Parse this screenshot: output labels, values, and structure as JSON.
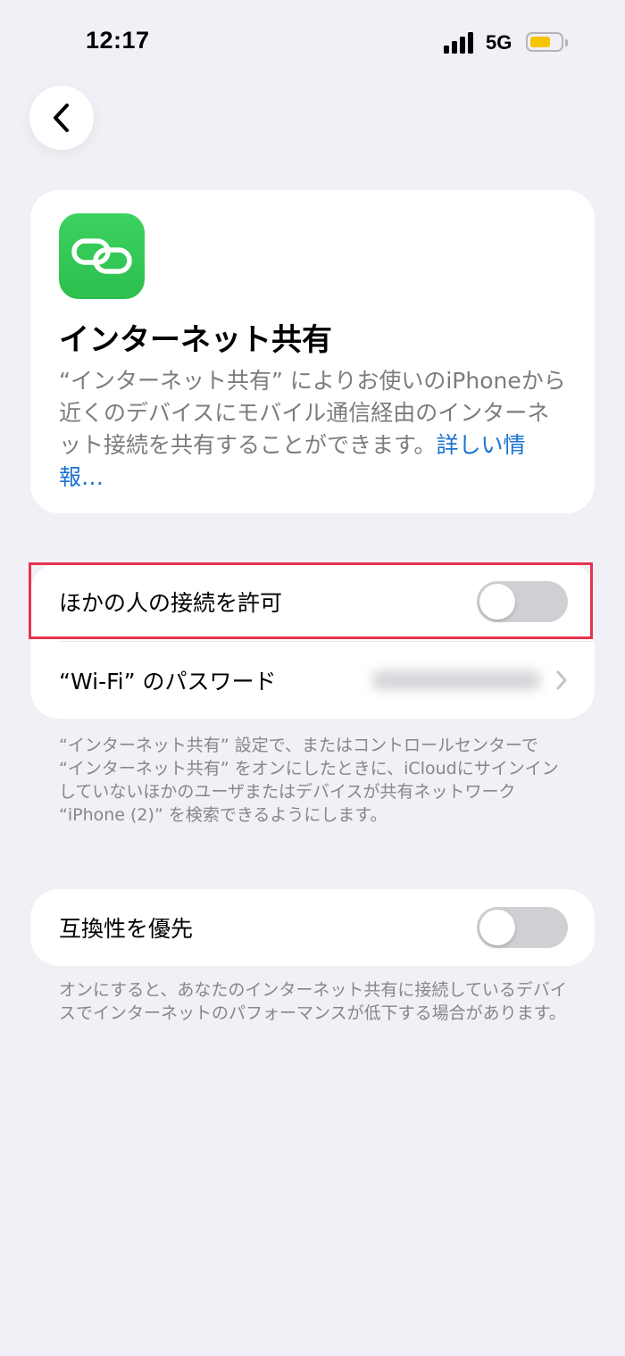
{
  "status_bar": {
    "time": "12:17",
    "network": "5G"
  },
  "header": {
    "back_icon": "chevron-left-icon"
  },
  "hero": {
    "icon": "link-icon",
    "title": "インターネット共有",
    "description": "“インターネット共有” によりお使いのiPhoneから近くのデバイスにモバイル通信経由のインターネット接続を共有することができます。",
    "link": "詳しい情報…"
  },
  "settings_group_1": {
    "allow_others": {
      "label": "ほかの人の接続を許可",
      "enabled": false
    },
    "wifi_password": {
      "label": "“Wi-Fi” のパスワード"
    }
  },
  "footnote_1": "“インターネット共有” 設定で、またはコントロールセンターで “インターネット共有” をオンにしたときに、iCloudにサインインしていないほかのユーザまたはデバイスが共有ネットワーク “iPhone (2)” を検索できるようにします。",
  "settings_group_2": {
    "maximize_compatibility": {
      "label": "互換性を優先",
      "enabled": false
    }
  },
  "footnote_2": "オンにすると、あなたのインターネット共有に接続しているデバイスでインターネットのパフォーマンスが低下する場合があります。",
  "colors": {
    "background": "#f0f0f6",
    "link": "#1a73d1",
    "toggle_off": "#d0d0d4",
    "app_icon": "#34c759",
    "highlight": "#e8334f",
    "battery": "#f7c400"
  }
}
